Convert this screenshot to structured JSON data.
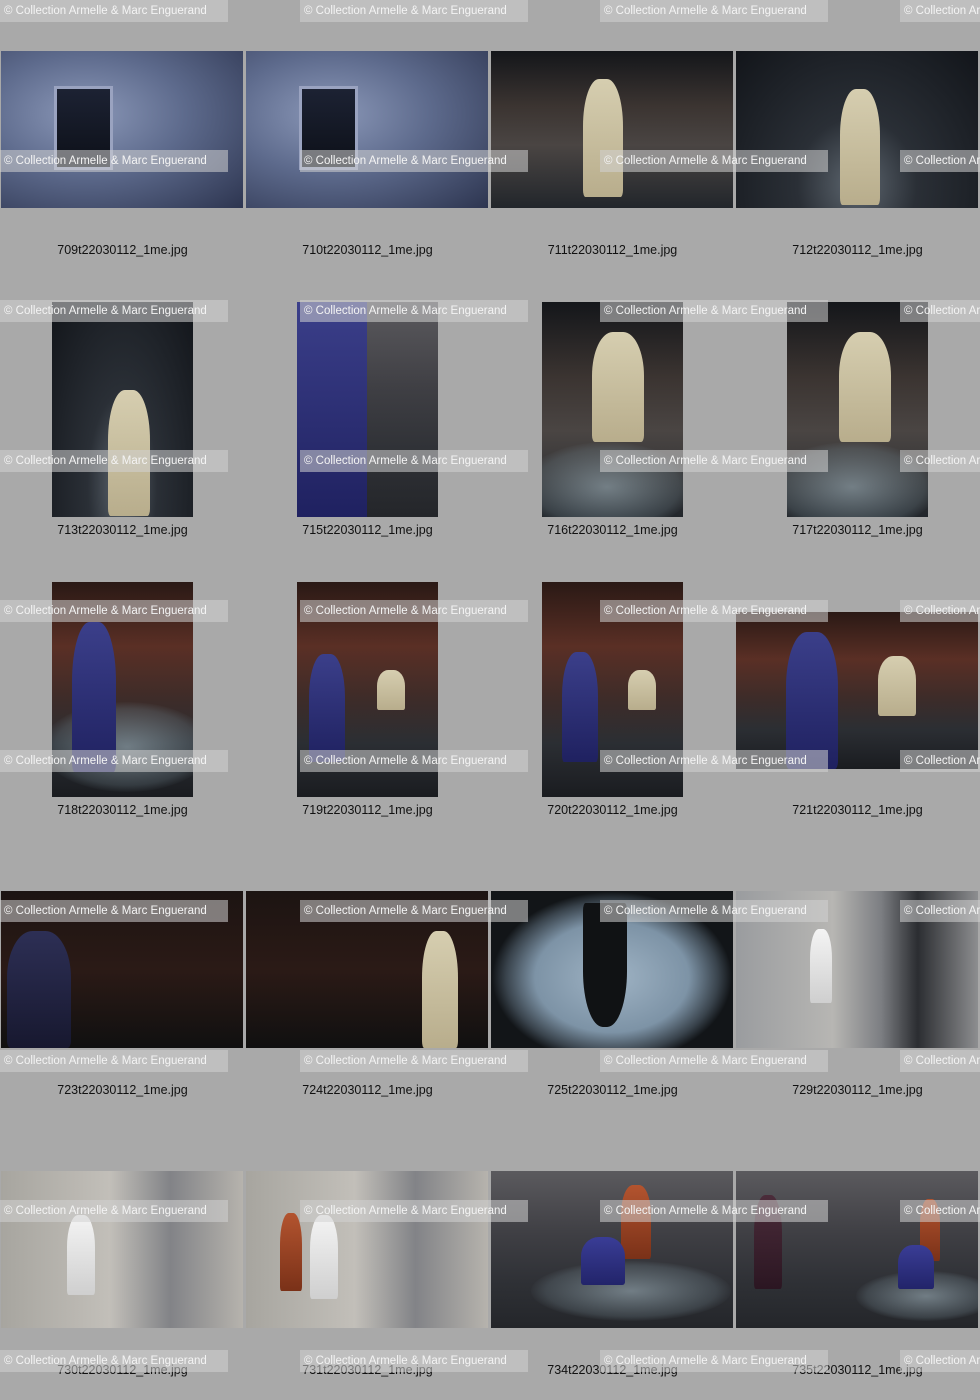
{
  "watermark": "© Collection Armelle & Marc Enguerand",
  "thumbnails": [
    {
      "file": "709t22030112_1me.jpg"
    },
    {
      "file": "710t22030112_1me.jpg"
    },
    {
      "file": "711t22030112_1me.jpg"
    },
    {
      "file": "712t22030112_1me.jpg"
    },
    {
      "file": "713t22030112_1me.jpg"
    },
    {
      "file": "715t22030112_1me.jpg"
    },
    {
      "file": "716t22030112_1me.jpg"
    },
    {
      "file": "717t22030112_1me.jpg"
    },
    {
      "file": "718t22030112_1me.jpg"
    },
    {
      "file": "719t22030112_1me.jpg"
    },
    {
      "file": "720t22030112_1me.jpg"
    },
    {
      "file": "721t22030112_1me.jpg"
    },
    {
      "file": "723t22030112_1me.jpg"
    },
    {
      "file": "724t22030112_1me.jpg"
    },
    {
      "file": "725t22030112_1me.jpg"
    },
    {
      "file": "729t22030112_1me.jpg"
    },
    {
      "file": "730t22030112_1me.jpg"
    },
    {
      "file": "731t22030112_1me.jpg"
    },
    {
      "file": "734t22030112_1me.jpg"
    },
    {
      "file": "735t22030112_1me.jpg"
    }
  ]
}
